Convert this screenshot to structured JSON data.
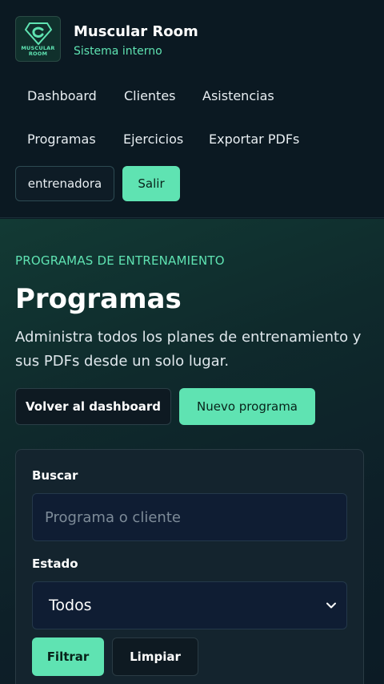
{
  "brand": {
    "logo_text_line1": "MUSCULAR",
    "logo_text_line2": "ROOM",
    "title": "Muscular Room",
    "subtitle": "Sistema interno"
  },
  "nav": {
    "items": [
      {
        "label": "Dashboard"
      },
      {
        "label": "Clientes"
      },
      {
        "label": "Asistencias"
      },
      {
        "label": "Programas"
      },
      {
        "label": "Ejercicios"
      },
      {
        "label": "Exportar PDFs"
      }
    ],
    "user_label": "entrenadora",
    "logout_label": "Salir"
  },
  "main": {
    "eyebrow": "PROGRAMAS DE ENTRENAMIENTO",
    "title": "Programas",
    "description": "Administra todos los planes de entrenamiento y sus PDFs desde un solo lugar.",
    "back_label": "Volver al dashboard",
    "new_label": "Nuevo programa"
  },
  "filters": {
    "search_label": "Buscar",
    "search_placeholder": "Programa o cliente",
    "status_label": "Estado",
    "status_value": "Todos",
    "filter_label": "Filtrar",
    "clear_label": "Limpiar"
  },
  "colors": {
    "accent": "#5fe3b2",
    "background": "#0b1a24"
  }
}
